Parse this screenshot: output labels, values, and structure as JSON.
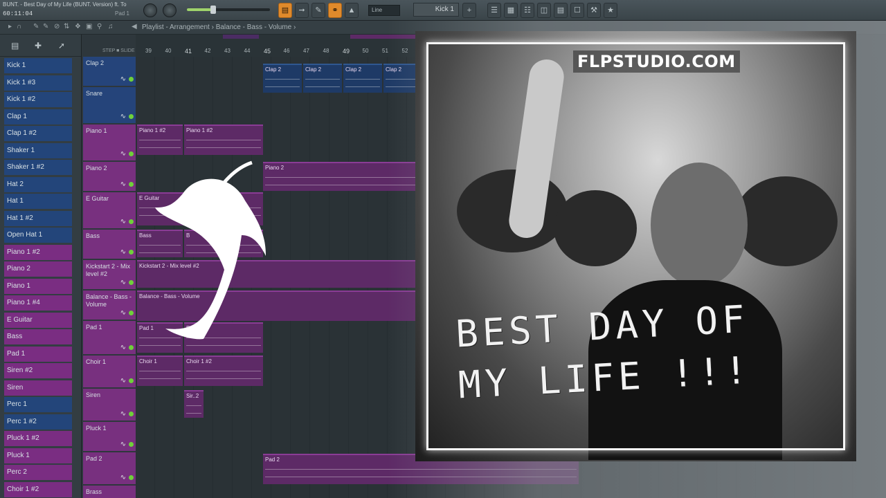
{
  "topbar": {
    "song_title": "BUNT. - Best Day of My Life (BUNT. Version) ft. To",
    "time": "60:11:04",
    "pad_label": "Pad 1",
    "snap": "Line",
    "channel": "Kick 1"
  },
  "navbar": {
    "breadcrumb": "Playlist - Arrangement  ›  Balance - Bass - Volume  ›"
  },
  "picker": {
    "items": [
      {
        "label": "Kick 1",
        "color": "blue"
      },
      {
        "label": "Kick 1 #3",
        "color": "blue"
      },
      {
        "label": "Kick 1 #2",
        "color": "blue"
      },
      {
        "label": "Clap 1",
        "color": "blue"
      },
      {
        "label": "Clap 1 #2",
        "color": "blue"
      },
      {
        "label": "Shaker 1",
        "color": "blue"
      },
      {
        "label": "Shaker 1 #2",
        "color": "blue"
      },
      {
        "label": "Hat 2",
        "color": "blue"
      },
      {
        "label": "Hat 1",
        "color": "blue"
      },
      {
        "label": "Hat 1 #2",
        "color": "blue"
      },
      {
        "label": "Open Hat 1",
        "color": "blue"
      },
      {
        "label": "Piano 1 #2",
        "color": "pink"
      },
      {
        "label": "Piano 2",
        "color": "pink"
      },
      {
        "label": "Piano 1",
        "color": "pink"
      },
      {
        "label": "Piano 1 #4",
        "color": "pink"
      },
      {
        "label": "E Guitar",
        "color": "pink"
      },
      {
        "label": "Bass",
        "color": "pink"
      },
      {
        "label": "Pad 1",
        "color": "pink"
      },
      {
        "label": "Siren #2",
        "color": "pink"
      },
      {
        "label": "Siren",
        "color": "pink"
      },
      {
        "label": "Perc 1",
        "color": "blue"
      },
      {
        "label": "Perc 1 #2",
        "color": "blue"
      },
      {
        "label": "Pluck 1 #2",
        "color": "pink"
      },
      {
        "label": "Pluck 1",
        "color": "pink"
      },
      {
        "label": "Perc 2",
        "color": "pink"
      },
      {
        "label": "Choir 1 #2",
        "color": "pink"
      }
    ]
  },
  "tracks": [
    {
      "label": "Clap 2",
      "color": "blue"
    },
    {
      "label": "Snare",
      "color": "blue"
    },
    {
      "label": "Piano 1",
      "color": "pink"
    },
    {
      "label": "Piano 2",
      "color": "pink"
    },
    {
      "label": "E Guitar",
      "color": "pink"
    },
    {
      "label": "Bass",
      "color": "pink"
    },
    {
      "label": "Kickstart 2 - Mix level #2",
      "color": "pink"
    },
    {
      "label": "Balance - Bass - Volume",
      "color": "pink"
    },
    {
      "label": "Pad 1",
      "color": "pink"
    },
    {
      "label": "Choir 1",
      "color": "pink"
    },
    {
      "label": "Siren",
      "color": "pink"
    },
    {
      "label": "Pluck 1",
      "color": "pink"
    },
    {
      "label": "Pad 2",
      "color": "pink"
    },
    {
      "label": "Brass",
      "color": "pink"
    }
  ],
  "ruler": {
    "numbers": [
      "39",
      "40",
      "41",
      "42",
      "43",
      "44",
      "45",
      "46",
      "47",
      "48",
      "49",
      "50",
      "51",
      "52"
    ]
  },
  "clips": {
    "clap2": [
      "Clap 2",
      "Clap 2",
      "Clap 2",
      "Clap 2"
    ],
    "piano1": [
      "Piano 1 #2",
      "Piano 1 #2"
    ],
    "piano2": "Piano 2",
    "eguitar": "E Guitar",
    "bass": [
      "Bass",
      "B"
    ],
    "kickstart": "Kickstart 2 - Mix level #2",
    "balance": "Balance - Bass - Volume",
    "pad1": [
      "Pad 1",
      "Pad 1"
    ],
    "choir1": [
      "Choir 1",
      "Choir 1 #2"
    ],
    "siren": "Sir..2",
    "pad2": "Pad 2"
  },
  "art": {
    "brand": "FLPSTUDIO.COM",
    "title_line1": "BEST DAY OF",
    "title_line2": "MY LIFE !!!"
  },
  "colors": {
    "blue_track": "#25447a",
    "pink_track": "#78307f",
    "accent_orange": "#e08a2b",
    "led_green": "#6fd13a"
  }
}
